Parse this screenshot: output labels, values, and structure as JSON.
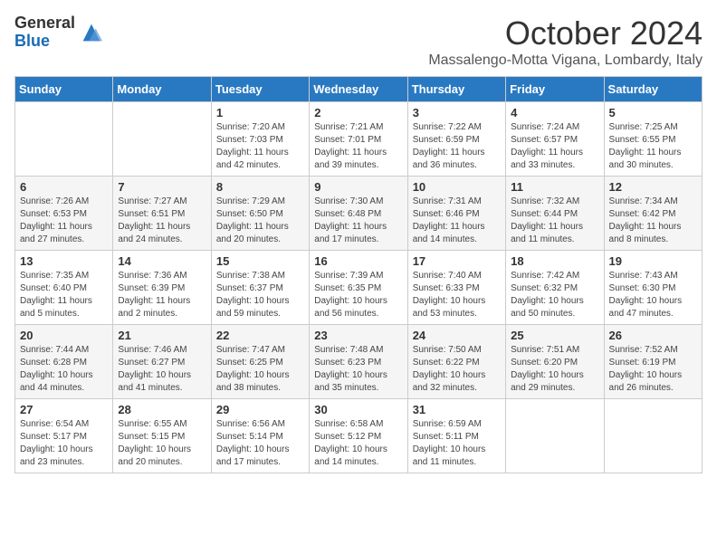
{
  "logo": {
    "general": "General",
    "blue": "Blue"
  },
  "title": "October 2024",
  "location": "Massalengo-Motta Vigana, Lombardy, Italy",
  "days_of_week": [
    "Sunday",
    "Monday",
    "Tuesday",
    "Wednesday",
    "Thursday",
    "Friday",
    "Saturday"
  ],
  "weeks": [
    [
      {
        "day": "",
        "sunrise": "",
        "sunset": "",
        "daylight": ""
      },
      {
        "day": "",
        "sunrise": "",
        "sunset": "",
        "daylight": ""
      },
      {
        "day": "1",
        "sunrise": "Sunrise: 7:20 AM",
        "sunset": "Sunset: 7:03 PM",
        "daylight": "Daylight: 11 hours and 42 minutes."
      },
      {
        "day": "2",
        "sunrise": "Sunrise: 7:21 AM",
        "sunset": "Sunset: 7:01 PM",
        "daylight": "Daylight: 11 hours and 39 minutes."
      },
      {
        "day": "3",
        "sunrise": "Sunrise: 7:22 AM",
        "sunset": "Sunset: 6:59 PM",
        "daylight": "Daylight: 11 hours and 36 minutes."
      },
      {
        "day": "4",
        "sunrise": "Sunrise: 7:24 AM",
        "sunset": "Sunset: 6:57 PM",
        "daylight": "Daylight: 11 hours and 33 minutes."
      },
      {
        "day": "5",
        "sunrise": "Sunrise: 7:25 AM",
        "sunset": "Sunset: 6:55 PM",
        "daylight": "Daylight: 11 hours and 30 minutes."
      }
    ],
    [
      {
        "day": "6",
        "sunrise": "Sunrise: 7:26 AM",
        "sunset": "Sunset: 6:53 PM",
        "daylight": "Daylight: 11 hours and 27 minutes."
      },
      {
        "day": "7",
        "sunrise": "Sunrise: 7:27 AM",
        "sunset": "Sunset: 6:51 PM",
        "daylight": "Daylight: 11 hours and 24 minutes."
      },
      {
        "day": "8",
        "sunrise": "Sunrise: 7:29 AM",
        "sunset": "Sunset: 6:50 PM",
        "daylight": "Daylight: 11 hours and 20 minutes."
      },
      {
        "day": "9",
        "sunrise": "Sunrise: 7:30 AM",
        "sunset": "Sunset: 6:48 PM",
        "daylight": "Daylight: 11 hours and 17 minutes."
      },
      {
        "day": "10",
        "sunrise": "Sunrise: 7:31 AM",
        "sunset": "Sunset: 6:46 PM",
        "daylight": "Daylight: 11 hours and 14 minutes."
      },
      {
        "day": "11",
        "sunrise": "Sunrise: 7:32 AM",
        "sunset": "Sunset: 6:44 PM",
        "daylight": "Daylight: 11 hours and 11 minutes."
      },
      {
        "day": "12",
        "sunrise": "Sunrise: 7:34 AM",
        "sunset": "Sunset: 6:42 PM",
        "daylight": "Daylight: 11 hours and 8 minutes."
      }
    ],
    [
      {
        "day": "13",
        "sunrise": "Sunrise: 7:35 AM",
        "sunset": "Sunset: 6:40 PM",
        "daylight": "Daylight: 11 hours and 5 minutes."
      },
      {
        "day": "14",
        "sunrise": "Sunrise: 7:36 AM",
        "sunset": "Sunset: 6:39 PM",
        "daylight": "Daylight: 11 hours and 2 minutes."
      },
      {
        "day": "15",
        "sunrise": "Sunrise: 7:38 AM",
        "sunset": "Sunset: 6:37 PM",
        "daylight": "Daylight: 10 hours and 59 minutes."
      },
      {
        "day": "16",
        "sunrise": "Sunrise: 7:39 AM",
        "sunset": "Sunset: 6:35 PM",
        "daylight": "Daylight: 10 hours and 56 minutes."
      },
      {
        "day": "17",
        "sunrise": "Sunrise: 7:40 AM",
        "sunset": "Sunset: 6:33 PM",
        "daylight": "Daylight: 10 hours and 53 minutes."
      },
      {
        "day": "18",
        "sunrise": "Sunrise: 7:42 AM",
        "sunset": "Sunset: 6:32 PM",
        "daylight": "Daylight: 10 hours and 50 minutes."
      },
      {
        "day": "19",
        "sunrise": "Sunrise: 7:43 AM",
        "sunset": "Sunset: 6:30 PM",
        "daylight": "Daylight: 10 hours and 47 minutes."
      }
    ],
    [
      {
        "day": "20",
        "sunrise": "Sunrise: 7:44 AM",
        "sunset": "Sunset: 6:28 PM",
        "daylight": "Daylight: 10 hours and 44 minutes."
      },
      {
        "day": "21",
        "sunrise": "Sunrise: 7:46 AM",
        "sunset": "Sunset: 6:27 PM",
        "daylight": "Daylight: 10 hours and 41 minutes."
      },
      {
        "day": "22",
        "sunrise": "Sunrise: 7:47 AM",
        "sunset": "Sunset: 6:25 PM",
        "daylight": "Daylight: 10 hours and 38 minutes."
      },
      {
        "day": "23",
        "sunrise": "Sunrise: 7:48 AM",
        "sunset": "Sunset: 6:23 PM",
        "daylight": "Daylight: 10 hours and 35 minutes."
      },
      {
        "day": "24",
        "sunrise": "Sunrise: 7:50 AM",
        "sunset": "Sunset: 6:22 PM",
        "daylight": "Daylight: 10 hours and 32 minutes."
      },
      {
        "day": "25",
        "sunrise": "Sunrise: 7:51 AM",
        "sunset": "Sunset: 6:20 PM",
        "daylight": "Daylight: 10 hours and 29 minutes."
      },
      {
        "day": "26",
        "sunrise": "Sunrise: 7:52 AM",
        "sunset": "Sunset: 6:19 PM",
        "daylight": "Daylight: 10 hours and 26 minutes."
      }
    ],
    [
      {
        "day": "27",
        "sunrise": "Sunrise: 6:54 AM",
        "sunset": "Sunset: 5:17 PM",
        "daylight": "Daylight: 10 hours and 23 minutes."
      },
      {
        "day": "28",
        "sunrise": "Sunrise: 6:55 AM",
        "sunset": "Sunset: 5:15 PM",
        "daylight": "Daylight: 10 hours and 20 minutes."
      },
      {
        "day": "29",
        "sunrise": "Sunrise: 6:56 AM",
        "sunset": "Sunset: 5:14 PM",
        "daylight": "Daylight: 10 hours and 17 minutes."
      },
      {
        "day": "30",
        "sunrise": "Sunrise: 6:58 AM",
        "sunset": "Sunset: 5:12 PM",
        "daylight": "Daylight: 10 hours and 14 minutes."
      },
      {
        "day": "31",
        "sunrise": "Sunrise: 6:59 AM",
        "sunset": "Sunset: 5:11 PM",
        "daylight": "Daylight: 10 hours and 11 minutes."
      },
      {
        "day": "",
        "sunrise": "",
        "sunset": "",
        "daylight": ""
      },
      {
        "day": "",
        "sunrise": "",
        "sunset": "",
        "daylight": ""
      }
    ]
  ]
}
